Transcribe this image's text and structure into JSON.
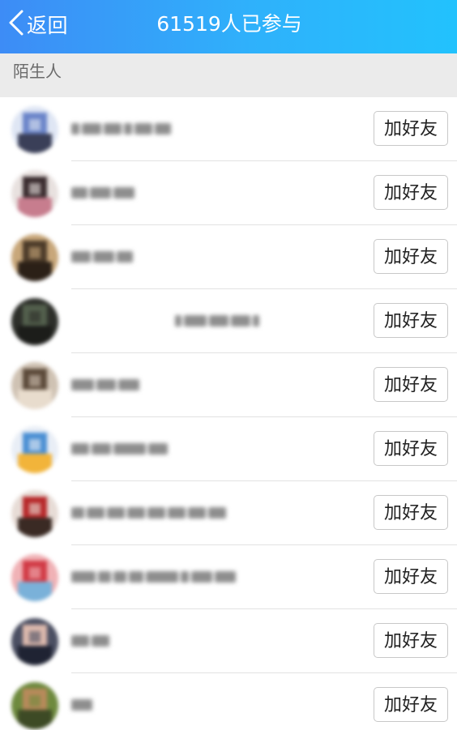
{
  "header": {
    "back_label": "返回",
    "title": "61519人已参与",
    "gradient_start": "#3d8cf6",
    "gradient_end": "#22c2fd"
  },
  "section": {
    "label": "陌生人"
  },
  "rows": [
    {
      "add_label": "加好友",
      "avatar_colors": [
        "#dfe6f4",
        "#6a84c9",
        "#3a3f58"
      ]
    },
    {
      "add_label": "加好友",
      "avatar_colors": [
        "#e8e1df",
        "#3a2c2f",
        "#c77d8e"
      ]
    },
    {
      "add_label": "加好友",
      "avatar_colors": [
        "#c8a77a",
        "#4c3b29",
        "#2b2017"
      ]
    },
    {
      "add_label": "加好友",
      "avatar_colors": [
        "#2d2f2a",
        "#53604d",
        "#1c1d1a"
      ]
    },
    {
      "add_label": "加好友",
      "avatar_colors": [
        "#cfc2b3",
        "#5c4a3a",
        "#e8dccd"
      ]
    },
    {
      "add_label": "加好友",
      "avatar_colors": [
        "#e9eef6",
        "#4b8fd3",
        "#f2b43a"
      ]
    },
    {
      "add_label": "加好友",
      "avatar_colors": [
        "#e7dcd6",
        "#b7282a",
        "#3a2a24"
      ]
    },
    {
      "add_label": "加好友",
      "avatar_colors": [
        "#f0b2b6",
        "#d13b46",
        "#7ab1d9"
      ]
    },
    {
      "add_label": "加好友",
      "avatar_colors": [
        "#4b4f62",
        "#dcb9ad",
        "#1f2333"
      ]
    },
    {
      "add_label": "加好友",
      "avatar_colors": [
        "#6e8a3e",
        "#b88a5b",
        "#3d4a25"
      ]
    }
  ]
}
